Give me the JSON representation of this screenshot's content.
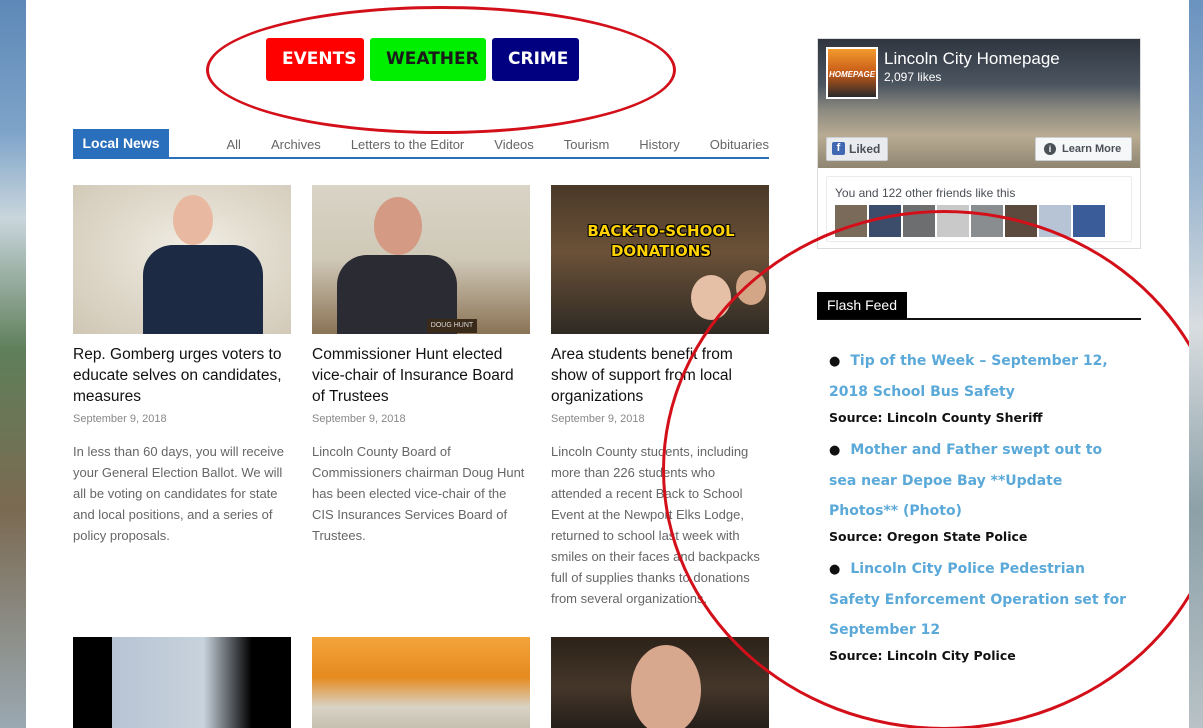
{
  "top_buttons": {
    "events": "EVENTS",
    "weather": "WEATHER",
    "crime": "CRIME"
  },
  "local_news": {
    "tab_active": "Local News",
    "tabs": [
      "All",
      "Archives",
      "Letters to the Editor",
      "Videos",
      "Tourism",
      "History",
      "Obituaries"
    ]
  },
  "articles": [
    {
      "title": "Rep. Gomberg urges voters to educate selves on candidates, measures",
      "date": "September 9, 2018",
      "excerpt": "In less than 60 days, you will receive your General Election Ballot. We will all be voting on candidates for state and local positions, and a series of policy proposals."
    },
    {
      "title": "Commissioner Hunt elected vice-chair of Insurance Board of Trustees",
      "date": "September 9, 2018",
      "excerpt": "Lincoln County Board of Commissioners chairman Doug Hunt has been elected vice-chair of the CIS Insurances Services Board of Trustees.",
      "nameplate": "DOUG HUNT"
    },
    {
      "title": "Area students benefit from show of support from local organizations",
      "date": "September 9, 2018",
      "excerpt": "Lincoln County students, including more than 226 students who attended a recent Back to School Event at the Newport Elks Lodge, returned to school last week with smiles on their faces and backpacks full of supplies thanks to donations from several organizations.",
      "image_text": "BACK-TO-SCHOOL DONATIONS"
    }
  ],
  "facebook": {
    "page_name": "Lincoln City Homepage",
    "likes": "2,097 likes",
    "logo_text": "HOMEPAGE",
    "liked_label": "Liked",
    "learn_more_label": "Learn More",
    "friends_text": "You and 122 other friends like this"
  },
  "flash_feed": {
    "title": "Flash Feed",
    "items": [
      {
        "link": "Tip of the Week – September 12, 2018 School Bus Safety",
        "source": "Source: Lincoln County Sheriff"
      },
      {
        "link": "Mother and Father swept out to sea near Depoe Bay **Update Photos** (Photo)",
        "source": "Source: Oregon State Police"
      },
      {
        "link": "Lincoln City Police Pedestrian Safety Enforcement Operation set for September 12",
        "source": "Source: Lincoln City Police"
      }
    ]
  },
  "colors": {
    "events": "#ff0000",
    "weather": "#00ee00",
    "crime": "#000080",
    "news_accent": "#2a6fbc",
    "feed_link": "#5aa9d9",
    "annotation": "#d3101a"
  }
}
